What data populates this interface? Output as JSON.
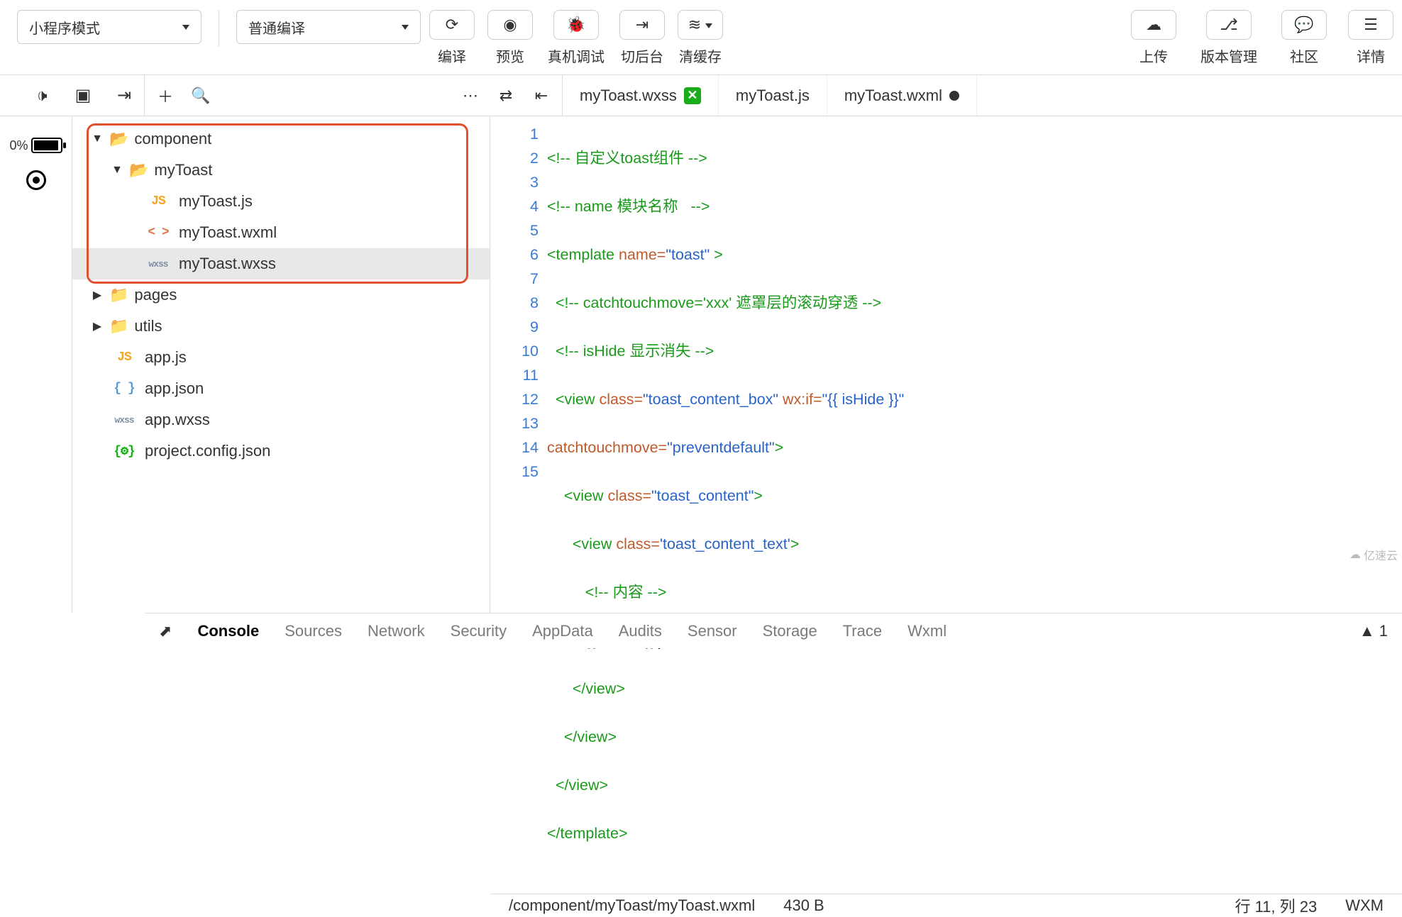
{
  "toolbar": {
    "mode_dropdown": "小程序模式",
    "compile_dropdown": "普通编译",
    "buttons": {
      "compile": "编译",
      "preview": "预览",
      "remote_debug": "真机调试",
      "switch_bg": "切后台",
      "clear_cache": "清缓存",
      "upload": "上传",
      "version": "版本管理",
      "community": "社区",
      "details": "详情"
    }
  },
  "tabs": {
    "t0": "myToast.wxss",
    "t1": "myToast.js",
    "t2": "myToast.wxml"
  },
  "tree": {
    "component": "component",
    "myToast": "myToast",
    "myToast_js": "myToast.js",
    "myToast_wxml": "myToast.wxml",
    "myToast_wxss": "myToast.wxss",
    "pages": "pages",
    "utils": "utils",
    "app_js": "app.js",
    "app_json": "app.json",
    "app_wxss": "app.wxss",
    "project_config": "project.config.json"
  },
  "sim": {
    "battery_pct": "0%"
  },
  "code": {
    "l1_a": "<!-- 自定义toast组件 -->",
    "l2_a": "<!-- name 模块名称   -->",
    "l3_tag_open": "<template",
    "l3_attr": " name=",
    "l3_str": "\"toast\"",
    "l3_close": " >",
    "l4_a": "<!-- catchtouchmove='xxx' 遮罩层的滚动穿透 -->",
    "l5_a": "<!-- isHide 显示消失 -->",
    "l6_tag": "<view",
    "l6_a1": " class=",
    "l6_s1": "\"toast_content_box\"",
    "l6_a2": " wx:if=",
    "l6_s2": "\"{{ isHide }}\"",
    "l7_attr": "catchtouchmove=",
    "l7_str": "\"preventdefault\"",
    "l7_close": ">",
    "l8_tag": "<view",
    "l8_attr": " class=",
    "l8_str": "\"toast_content\"",
    "l8_close": ">",
    "l9_tag": "<view",
    "l9_attr": " class=",
    "l9_str": "'toast_content_text'",
    "l9_close": ">",
    "l10_a": "<!-- 内容 -->",
    "l11_txt": "{{content}}",
    "l12": "</view>",
    "l13": "</view>",
    "l14": "</view>",
    "l15": "</template>"
  },
  "status": {
    "path": "/component/myToast/myToast.wxml",
    "size": "430 B",
    "cursor": "行 11,  列 23",
    "lang": "WXM",
    "warn_count": "1"
  },
  "devtools": {
    "console": "Console",
    "sources": "Sources",
    "network": "Network",
    "security": "Security",
    "appdata": "AppData",
    "audits": "Audits",
    "sensor": "Sensor",
    "storage": "Storage",
    "trace": "Trace",
    "wxml": "Wxml"
  },
  "watermark": "亿速云"
}
